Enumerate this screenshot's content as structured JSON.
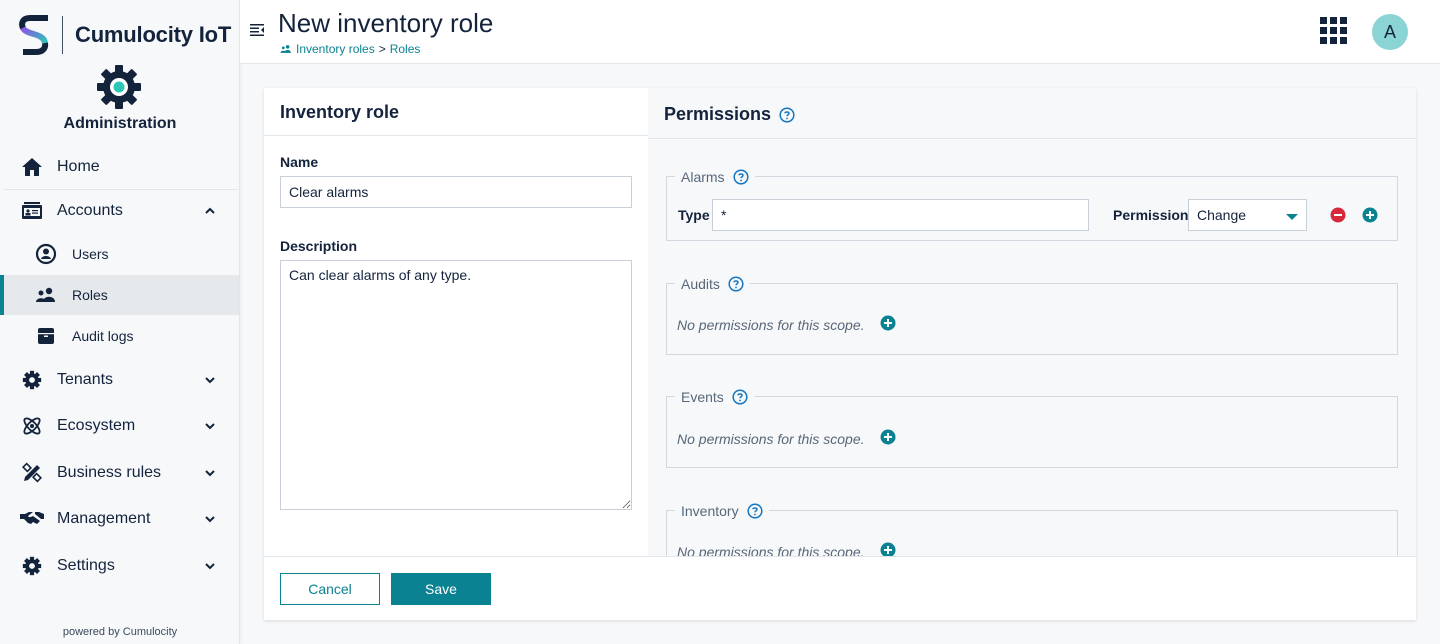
{
  "brand": {
    "name": "Cumulocity IoT",
    "app_name": "Administration"
  },
  "sidebar": {
    "home": {
      "label": "Home",
      "icon": "home-icon"
    },
    "accounts": {
      "label": "Accounts",
      "icon": "accounts-icon",
      "expanded": true,
      "items": [
        {
          "label": "Users",
          "icon": "user-circle-icon",
          "active": false
        },
        {
          "label": "Roles",
          "icon": "users-icon",
          "active": true
        },
        {
          "label": "Audit logs",
          "icon": "archive-icon",
          "active": false
        }
      ]
    },
    "groups": [
      {
        "label": "Tenants",
        "icon": "gear-icon"
      },
      {
        "label": "Ecosystem",
        "icon": "atom-icon"
      },
      {
        "label": "Business rules",
        "icon": "ruler-pencil-icon"
      },
      {
        "label": "Management",
        "icon": "handshake-icon"
      },
      {
        "label": "Settings",
        "icon": "gear-icon"
      }
    ],
    "powered_by": "powered by Cumulocity"
  },
  "header": {
    "title": "New inventory role",
    "breadcrumb": [
      {
        "label": "Inventory roles",
        "icon": "users-icon"
      },
      {
        "label": "Roles"
      }
    ],
    "breadcrumb_separator": ">",
    "avatar_initial": "A"
  },
  "form": {
    "section_title": "Inventory role",
    "name_label": "Name",
    "name_value": "Clear alarms",
    "description_label": "Description",
    "description_value": "Can clear alarms of any type."
  },
  "permissions": {
    "title": "Permissions",
    "scopes": [
      {
        "name": "Alarms",
        "entries": [
          {
            "type_label": "Type",
            "type_value": "*",
            "permission_label": "Permission",
            "permission_value": "Change"
          }
        ]
      },
      {
        "name": "Audits",
        "empty_text": "No permissions for this scope."
      },
      {
        "name": "Events",
        "empty_text": "No permissions for this scope."
      },
      {
        "name": "Inventory",
        "empty_text": "No permissions for this scope."
      }
    ]
  },
  "footer": {
    "cancel_label": "Cancel",
    "save_label": "Save"
  },
  "colors": {
    "primary": "#0a8291",
    "text": "#14233c",
    "danger": "#d6293b",
    "help": "#1776bf",
    "avatar_bg": "#8ad5d3"
  }
}
